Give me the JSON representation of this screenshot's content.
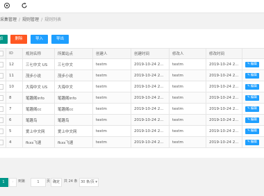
{
  "topbar": {
    "icons": [
      "target-icon",
      "refresh-icon"
    ]
  },
  "breadcrumb": {
    "items": [
      "采集管理",
      "规则管理",
      "规则列表"
    ]
  },
  "toolbar": {
    "add_label": "添加",
    "delete_label": "删除",
    "import_label": "导入",
    "export_label": "导出"
  },
  "table": {
    "columns": [
      "",
      "ID",
      "规则名称",
      "所属站点",
      "创建人",
      "创建时间",
      "修改人",
      "修改时间",
      ""
    ],
    "rows": [
      {
        "id": "12",
        "name": "三七中文 US",
        "site": "三七中文",
        "creator": "testm",
        "created": "2019-10-24 2...",
        "modifier": "testm",
        "modified": "2019-10-24 2..."
      },
      {
        "id": "11",
        "name": "茂步小说",
        "site": "茂步小说",
        "creator": "testm",
        "created": "2019-10-24 2...",
        "modifier": "testm",
        "modified": "2019-10-24 2..."
      },
      {
        "id": "10",
        "name": "大海中文 US",
        "site": "大海中文",
        "creator": "testm",
        "created": "2019-10-24 2...",
        "modifier": "testm",
        "modified": "2019-10-24 2..."
      },
      {
        "id": "8",
        "name": "笔趣阁info",
        "site": "笔趣阁info",
        "creator": "testm",
        "created": "2019-10-24 2...",
        "modifier": "testm",
        "modified": "2019-10-24 2..."
      },
      {
        "id": "7",
        "name": "笔趣阁cc",
        "site": "笔趣阁cc",
        "creator": "testm",
        "created": "2019-10-24 2...",
        "modifier": "testm",
        "modified": "2019-10-24 2..."
      },
      {
        "id": "6",
        "name": "笔趣鸟",
        "site": "笔趣鸟",
        "creator": "testm",
        "created": "2019-10-24 2...",
        "modifier": "testm",
        "modified": "2019-10-24 2..."
      },
      {
        "id": "5",
        "name": "爱上中文网",
        "site": "爱上中文网",
        "creator": "testm",
        "created": "2019-10-24 2...",
        "modifier": "testm",
        "modified": "2019-10-24 2..."
      },
      {
        "id": "4",
        "name": "fkxs飞速",
        "site": "fkxs飞速",
        "creator": "testm",
        "created": "2019-10-24 2...",
        "modifier": "testm",
        "modified": "2019-10-24 2..."
      }
    ],
    "edit_label": "编辑"
  },
  "pager": {
    "current_page": "1",
    "goto_label": "到第",
    "goto_value": "1",
    "page_unit": "页",
    "confirm_label": "确定",
    "total": "共 24 条",
    "page_size": "30 条/页"
  },
  "colors": {
    "green": "#009688",
    "red": "#ff5722",
    "blue": "#1e9fff"
  }
}
